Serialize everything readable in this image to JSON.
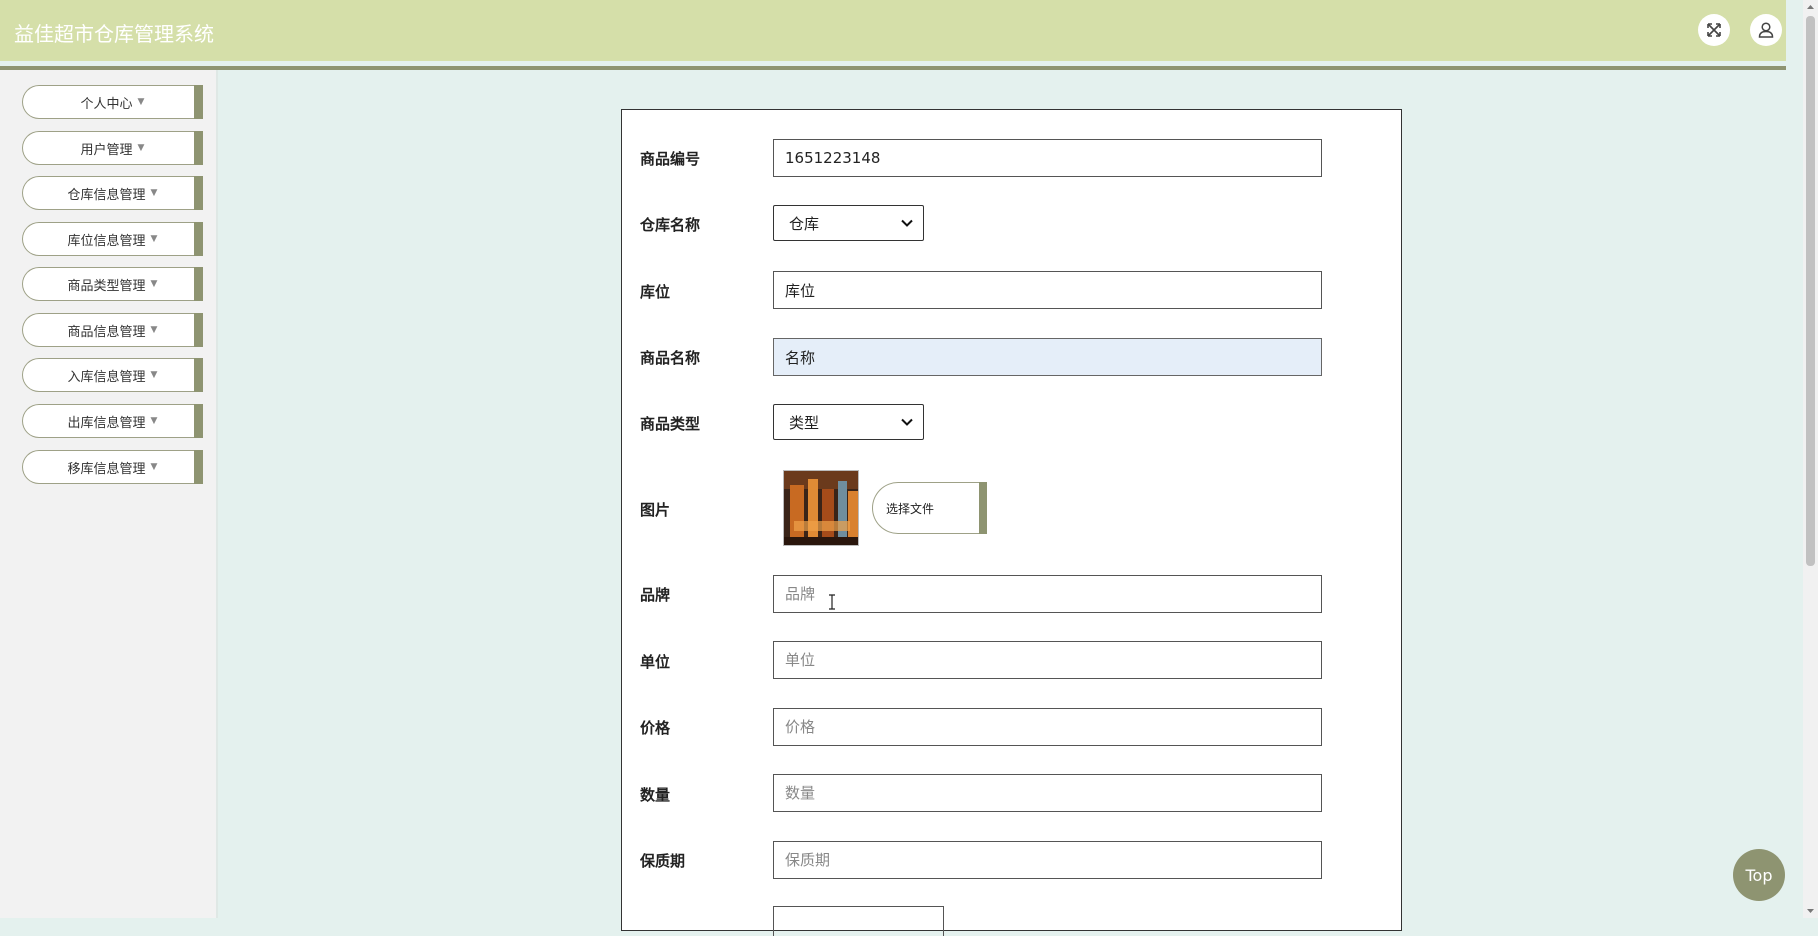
{
  "header": {
    "title": "益佳超市仓库管理系统",
    "fullscreen_icon": "expand-icon",
    "user_icon": "user-icon"
  },
  "sidebar": {
    "items": [
      {
        "label": "个人中心"
      },
      {
        "label": "用户管理"
      },
      {
        "label": "仓库信息管理"
      },
      {
        "label": "库位信息管理"
      },
      {
        "label": "商品类型管理"
      },
      {
        "label": "商品信息管理"
      },
      {
        "label": "入库信息管理"
      },
      {
        "label": "出库信息管理"
      },
      {
        "label": "移库信息管理"
      }
    ],
    "caret": "▼"
  },
  "form": {
    "product_code": {
      "label": "商品编号",
      "value": "1651223148",
      "placeholder": ""
    },
    "warehouse": {
      "label": "仓库名称",
      "selected": "仓库"
    },
    "location": {
      "label": "库位",
      "value": "库位",
      "placeholder": ""
    },
    "product_name": {
      "label": "商品名称",
      "value": "名称",
      "placeholder": ""
    },
    "product_type": {
      "label": "商品类型",
      "selected": "类型"
    },
    "image": {
      "label": "图片",
      "choose_file": "选择文件"
    },
    "brand": {
      "label": "品牌",
      "placeholder": "品牌"
    },
    "unit": {
      "label": "单位",
      "placeholder": "单位"
    },
    "price": {
      "label": "价格",
      "placeholder": "价格"
    },
    "quantity": {
      "label": "数量",
      "placeholder": "数量"
    },
    "shelf_life": {
      "label": "保质期",
      "placeholder": "保质期"
    }
  },
  "top_button": {
    "label": "Top"
  },
  "colors": {
    "header_bg": "#d5dfa9",
    "accent": "#8e9471",
    "page_bg": "#e4f1ee",
    "sidebar_bg": "#f2f2f2",
    "focused_input_bg": "#e5eef9"
  }
}
